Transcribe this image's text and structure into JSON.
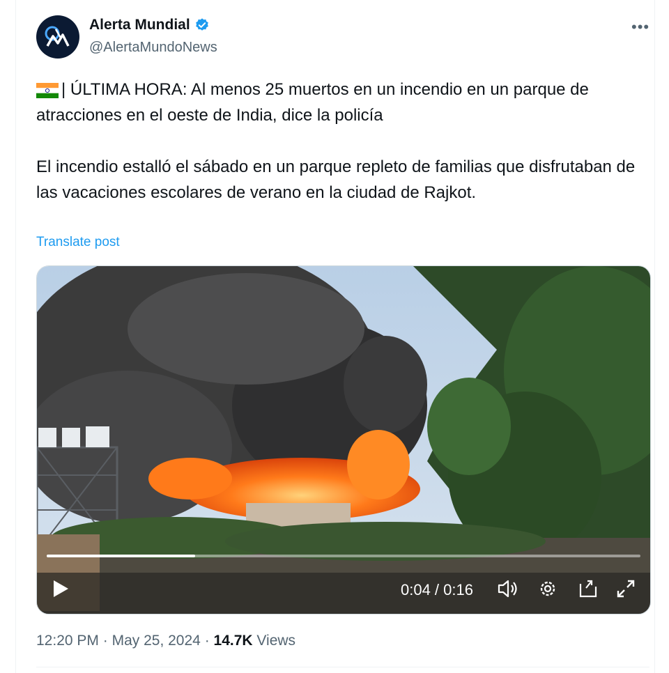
{
  "account": {
    "name": "Alerta Mundial",
    "handle": "@AlertaMundoNews",
    "avatar_text": "AM"
  },
  "post": {
    "line1": "| ÚLTIMA HORA: Al menos 25 muertos en un incendio en un parque de atracciones en el oeste de India, dice la policía",
    "line2": "El incendio estalló el sábado en un parque repleto de familias que disfrutaban de las vacaciones escolares de verano en la ciudad de Rajkot.",
    "translate_label": "Translate post"
  },
  "video": {
    "time": "0:04 / 0:16",
    "progress": 0.25
  },
  "meta": {
    "time": "12:20 PM",
    "date": "May 25, 2024",
    "views_count": "14.7K",
    "views_label": "Views",
    "sep": "·"
  },
  "colors": {
    "link": "#1d9bf0",
    "verified": "#1d9bf0",
    "muted": "#536471"
  },
  "icons": [
    "verified-badge-icon",
    "more-icon",
    "india-flag-icon",
    "play-icon",
    "volume-icon",
    "settings-icon",
    "pip-icon",
    "fullscreen-icon"
  ]
}
